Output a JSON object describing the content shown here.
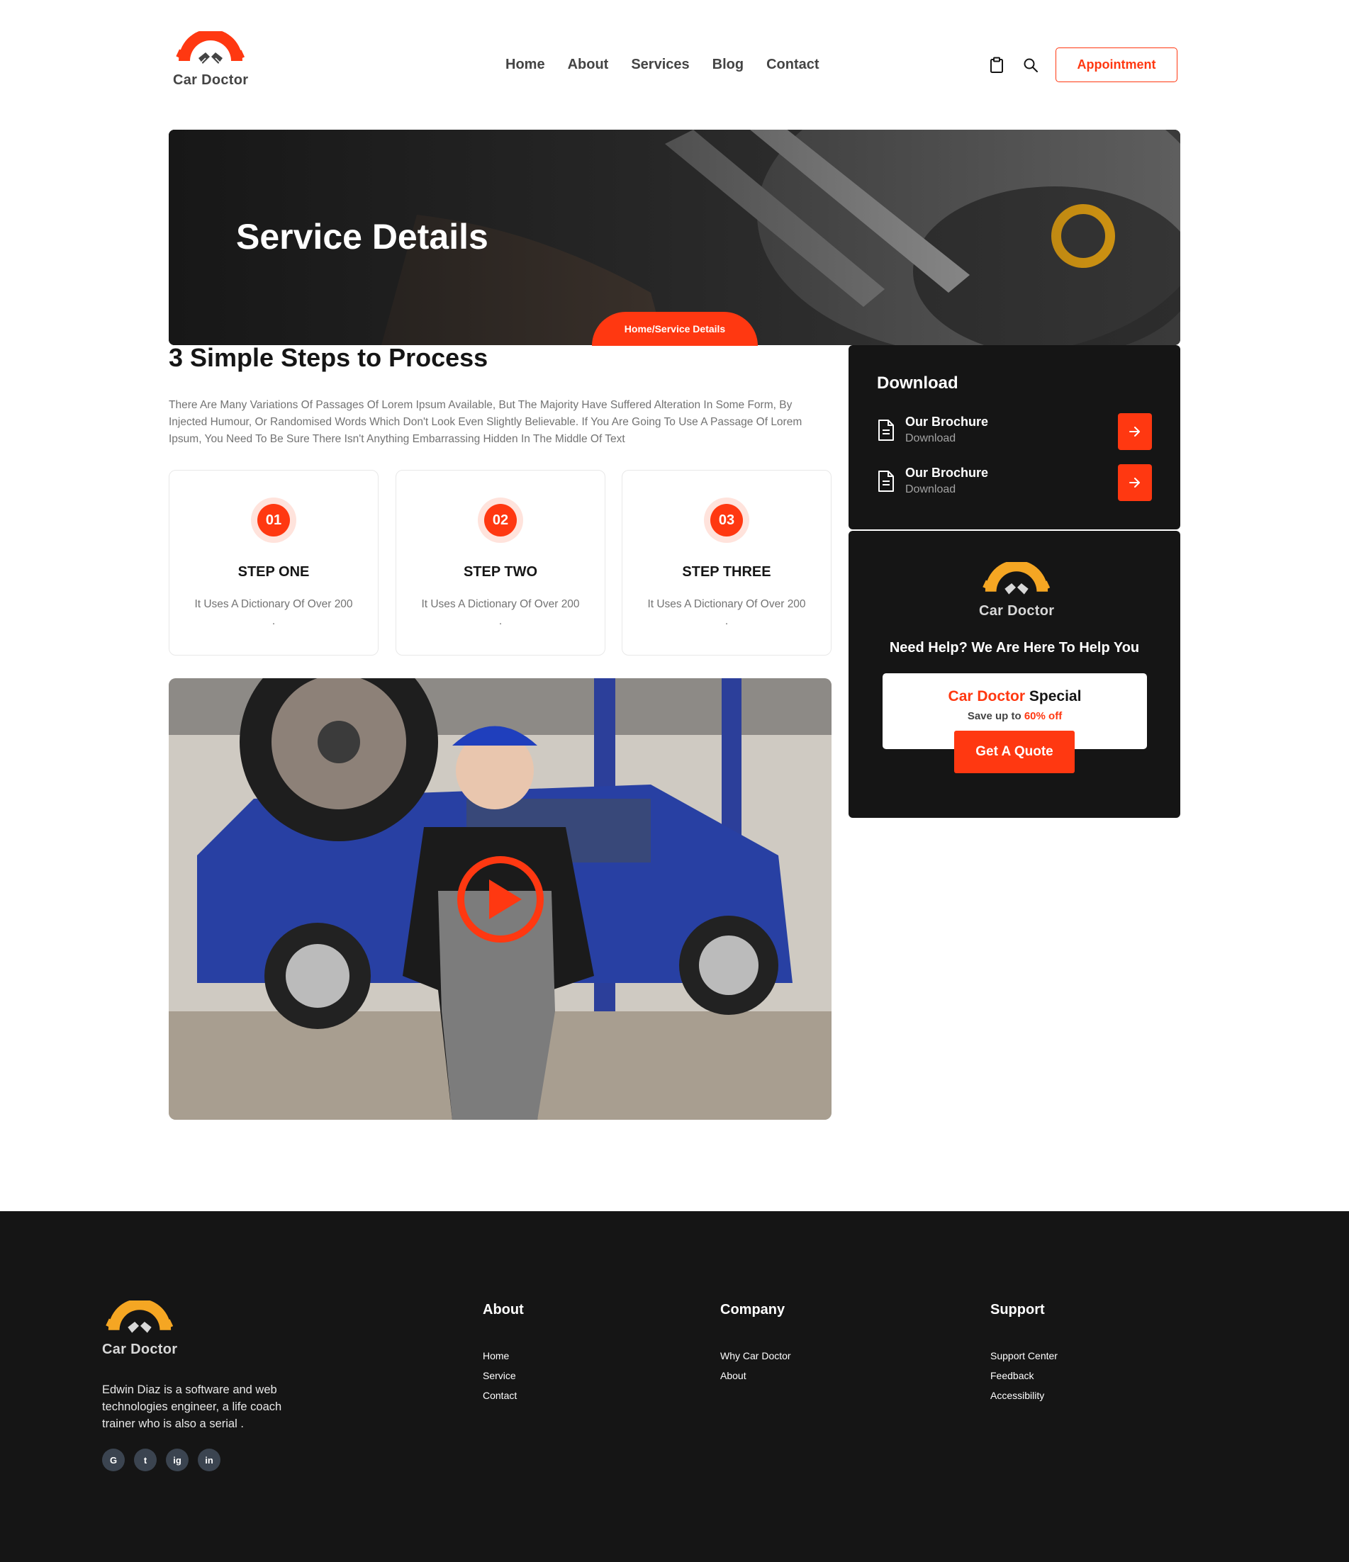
{
  "brand": {
    "name": "Car Doctor"
  },
  "header": {
    "nav": [
      "Home",
      "About",
      "Services",
      "Blog",
      "Contact"
    ],
    "appointment_label": "Appointment"
  },
  "hero": {
    "title": "Service Details",
    "breadcrumb": "Home/Service Details"
  },
  "process": {
    "heading": "3 Simple Steps to Process",
    "description": "There Are Many Variations Of Passages Of Lorem Ipsum Available, But The Majority Have Suffered Alteration In Some Form, By Injected Humour, Or Randomised Words Which Don't Look Even Slightly Believable. If You Are Going To Use A Passage Of Lorem Ipsum, You Need To Be Sure There Isn't Anything Embarrassing Hidden In The Middle Of Text",
    "steps": [
      {
        "number": "01",
        "title": "STEP ONE",
        "text": "It Uses A Dictionary Of Over 200 ."
      },
      {
        "number": "02",
        "title": "STEP TWO",
        "text": "It Uses A Dictionary Of Over 200 ."
      },
      {
        "number": "03",
        "title": "STEP THREE",
        "text": "It Uses A Dictionary Of Over 200 ."
      }
    ]
  },
  "sidebar": {
    "download_title": "Download",
    "downloads": [
      {
        "name": "Our Brochure",
        "sub": "Download"
      },
      {
        "name": "Our Brochure",
        "sub": "Download"
      }
    ],
    "help_heading": "Need Help? We Are Here To Help You",
    "special_brand": "Car Doctor",
    "special_word": "Special",
    "save_text": "Save up to",
    "save_amount": "60% off",
    "quote_label": "Get A Quote"
  },
  "footer": {
    "about": "Edwin Diaz is a software and web technologies engineer, a life coach trainer who is also a serial .",
    "socials": [
      "G",
      "t",
      "ig",
      "in"
    ],
    "columns": [
      {
        "title": "About",
        "links": [
          "Home",
          "Service",
          "Contact"
        ]
      },
      {
        "title": "Company",
        "links": [
          "Why Car Doctor",
          "About"
        ]
      },
      {
        "title": "Support",
        "links": [
          "Support Center",
          "Feedback",
          "Accessibility"
        ]
      }
    ]
  },
  "colors": {
    "accent": "#ff3811",
    "dark": "#151515",
    "logo_footer": "#f5a623"
  },
  "icons": [
    "clipboard-icon",
    "search-icon",
    "document-icon",
    "arrow-right-icon",
    "play-icon",
    "google-icon",
    "twitter-icon",
    "instagram-icon",
    "linkedin-icon"
  ]
}
